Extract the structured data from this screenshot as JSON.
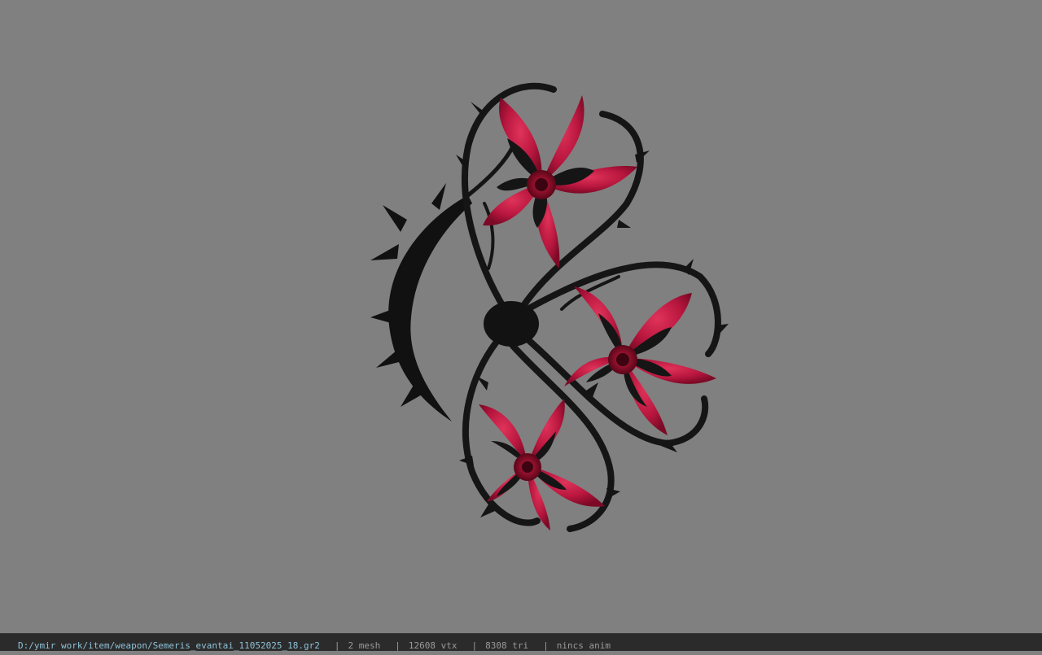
{
  "status_bar": {
    "file_path": "D:/ymir work/item/weapon/Semeris_evantai_11052025_18.gr2",
    "separator": "|",
    "mesh_count": "2 mesh",
    "vertex_count": "12608 vtx",
    "triangle_count": "8308 tri",
    "animation": "nincs anim"
  },
  "viewport": {
    "background_color": "#808080",
    "model_description_colors": {
      "thorns": "#141414",
      "petals": "#b0133a",
      "petal_highlight": "#d8284f",
      "center": "#8a0c28"
    }
  }
}
